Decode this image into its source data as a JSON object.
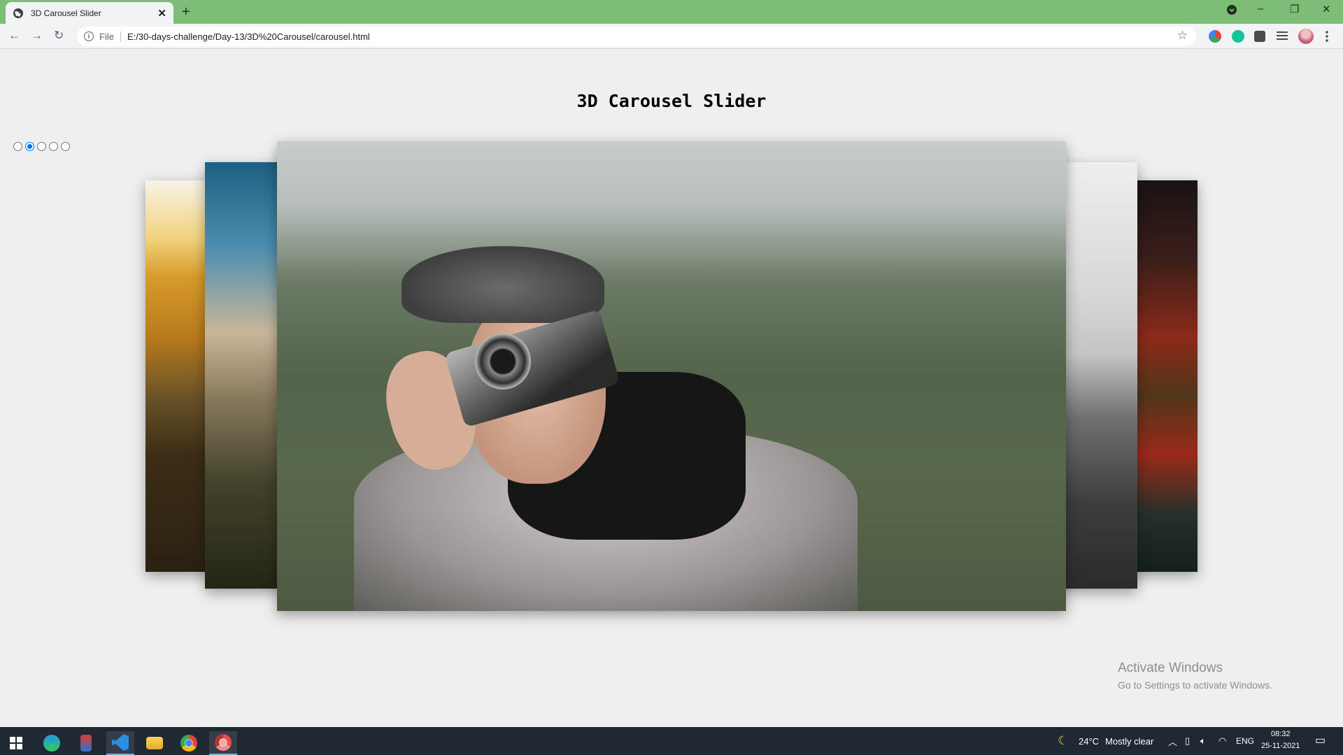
{
  "browser": {
    "tab": {
      "title": "3D Carousel Slider",
      "close": "✕"
    },
    "newtab": "+",
    "window_controls": {
      "minimize": "–",
      "maximize": "❐",
      "close": "✕"
    },
    "nav": {
      "back": "←",
      "forward": "→",
      "reload": "↻"
    },
    "address": {
      "scheme": "File",
      "url": "E:/30-days-challenge/Day-13/3D%20Carousel/carousel.html",
      "info": "i"
    }
  },
  "page": {
    "title": "3D Carousel Slider",
    "radio_count": 5,
    "active_index": 1
  },
  "watermark": {
    "title": "Activate Windows",
    "subtitle": "Go to Settings to activate Windows."
  },
  "taskbar": {
    "weather": {
      "temp": "24°C",
      "condition": "Mostly clear"
    },
    "language": "ENG",
    "time": "08:32",
    "date": "25-11-2021"
  },
  "colors": {
    "tabstrip": "#7dbd78",
    "radio_active": "#0075ff",
    "taskbar": "#1f2833"
  }
}
